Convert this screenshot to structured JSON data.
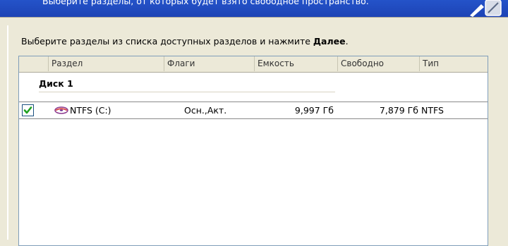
{
  "header": {
    "title_text": "Выберите разделы, от которых будет взято свободное пространство."
  },
  "instruction": {
    "text": "Выберите разделы из списка доступных разделов и нажмите ",
    "bold_text": "Далее",
    "suffix": "."
  },
  "table": {
    "columns": [
      "Раздел",
      "Флаги",
      "Емкость",
      "Свободно",
      "Тип"
    ],
    "group_label": "Диск 1",
    "rows": [
      {
        "checked": true,
        "partition": "NTFS (C:)",
        "flags": "Осн.,Акт.",
        "capacity": "9,997 Гб",
        "free": "7,879 Гб",
        "type": "NTFS"
      }
    ]
  },
  "icons": {
    "wizard": "disk-wizard-icon",
    "partition": "partition-disk-icon",
    "checkbox": "checkmark-icon"
  },
  "colors": {
    "header_band": "#2453c9",
    "dialog_bg": "#ece9d8",
    "list_border": "#7f9db9",
    "checkmark": "#21a121"
  }
}
